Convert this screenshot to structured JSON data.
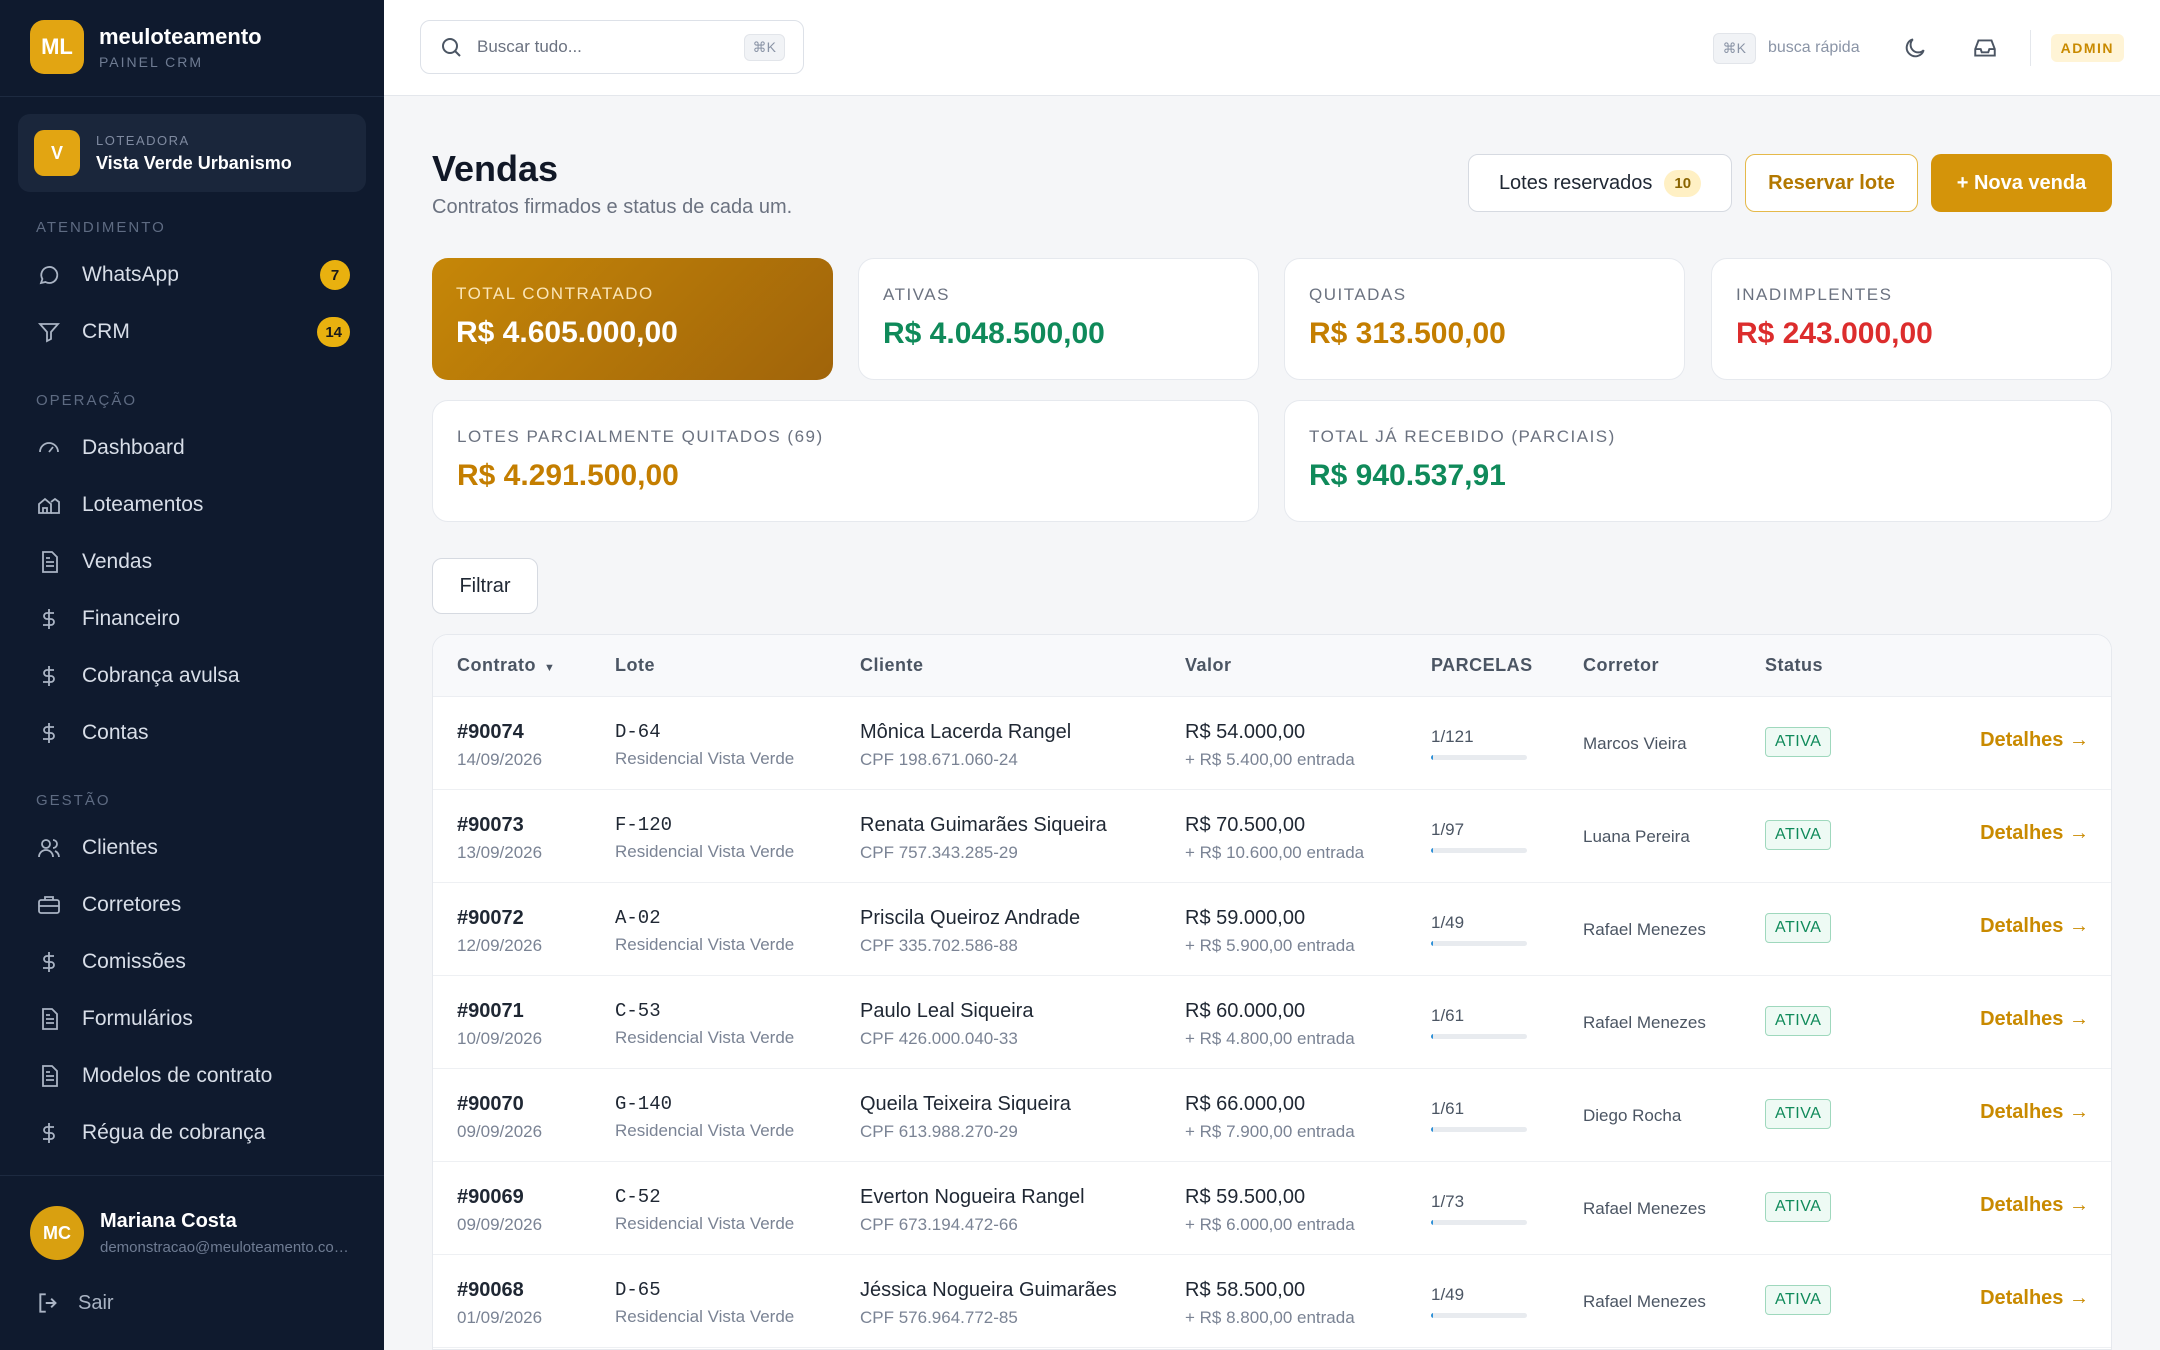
{
  "brand": {
    "logo": "ML",
    "name": "meuloteamento",
    "subtitle": "PAINEL CRM"
  },
  "org": {
    "badge": "V",
    "label": "LOTEADORA",
    "name": "Vista Verde Urbanismo"
  },
  "sidebar": {
    "sections": [
      {
        "label": "ATENDIMENTO"
      },
      {
        "label": "OPERAÇÃO"
      },
      {
        "label": "GESTÃO"
      }
    ],
    "items": [
      {
        "label": "WhatsApp",
        "icon": "chat-icon",
        "badge": "7"
      },
      {
        "label": "CRM",
        "icon": "filter-icon",
        "badge": "14"
      },
      {
        "label": "Dashboard",
        "icon": "gauge-icon"
      },
      {
        "label": "Loteamentos",
        "icon": "houses-icon"
      },
      {
        "label": "Vendas",
        "icon": "document-icon"
      },
      {
        "label": "Financeiro",
        "icon": "dollar-icon"
      },
      {
        "label": "Cobrança avulsa",
        "icon": "dollar-icon"
      },
      {
        "label": "Contas",
        "icon": "dollar-icon"
      },
      {
        "label": "Clientes",
        "icon": "users-icon"
      },
      {
        "label": "Corretores",
        "icon": "briefcase-icon"
      },
      {
        "label": "Comissões",
        "icon": "dollar-icon"
      },
      {
        "label": "Formulários",
        "icon": "document-icon"
      },
      {
        "label": "Modelos de contrato",
        "icon": "document-icon"
      },
      {
        "label": "Régua de cobrança",
        "icon": "dollar-icon"
      }
    ]
  },
  "user": {
    "initials": "MC",
    "name": "Mariana Costa",
    "email": "demonstracao@meuloteamento.com.br",
    "logout": "Sair"
  },
  "topbar": {
    "search_placeholder": "Buscar tudo...",
    "search_kbd": "⌘K",
    "quick_kbd": "⌘K",
    "quick_label": "busca rápida",
    "role": "ADMIN"
  },
  "page": {
    "title": "Vendas",
    "subtitle": "Contratos firmados e status de cada um.",
    "reserved_label": "Lotes reservados",
    "reserved_count": "10",
    "reserve_button": "Reservar lote",
    "new_button": "+ Nova venda",
    "filter_button": "Filtrar"
  },
  "stats": [
    {
      "label": "TOTAL CONTRATADO",
      "value": "R$ 4.605.000,00"
    },
    {
      "label": "ATIVAS",
      "value": "R$ 4.048.500,00"
    },
    {
      "label": "QUITADAS",
      "value": "R$ 313.500,00"
    },
    {
      "label": "INADIMPLENTES",
      "value": "R$ 243.000,00"
    },
    {
      "label": "LOTES PARCIALMENTE QUITADOS (69)",
      "value": "R$ 4.291.500,00"
    },
    {
      "label": "TOTAL JÁ RECEBIDO (PARCIAIS)",
      "value": "R$ 940.537,91"
    }
  ],
  "table": {
    "columns": [
      "Contrato",
      "Lote",
      "Cliente",
      "Valor",
      "PARCELAS",
      "Corretor",
      "Status"
    ],
    "rows": [
      {
        "contrato": "#90074",
        "data": "14/09/2026",
        "lote": "D-64",
        "loteamento": "Residencial Vista Verde",
        "cliente": "Mônica Lacerda Rangel",
        "cpf": "CPF 198.671.060-24",
        "valor": "R$ 54.000,00",
        "entrada": "+ R$ 5.400,00 entrada",
        "parcelas": "1/121",
        "progress": 0.008,
        "corretor": "Marcos Vieira",
        "status": "ATIVA",
        "acao": "Detalhes →"
      },
      {
        "contrato": "#90073",
        "data": "13/09/2026",
        "lote": "F-120",
        "loteamento": "Residencial Vista Verde",
        "cliente": "Renata Guimarães Siqueira",
        "cpf": "CPF 757.343.285-29",
        "valor": "R$ 70.500,00",
        "entrada": "+ R$ 10.600,00 entrada",
        "parcelas": "1/97",
        "progress": 0.01,
        "corretor": "Luana Pereira",
        "status": "ATIVA",
        "acao": "Detalhes →"
      },
      {
        "contrato": "#90072",
        "data": "12/09/2026",
        "lote": "A-02",
        "loteamento": "Residencial Vista Verde",
        "cliente": "Priscila Queiroz Andrade",
        "cpf": "CPF 335.702.586-88",
        "valor": "R$ 59.000,00",
        "entrada": "+ R$ 5.900,00 entrada",
        "parcelas": "1/49",
        "progress": 0.02,
        "corretor": "Rafael Menezes",
        "status": "ATIVA",
        "acao": "Detalhes →"
      },
      {
        "contrato": "#90071",
        "data": "10/09/2026",
        "lote": "C-53",
        "loteamento": "Residencial Vista Verde",
        "cliente": "Paulo Leal Siqueira",
        "cpf": "CPF 426.000.040-33",
        "valor": "R$ 60.000,00",
        "entrada": "+ R$ 4.800,00 entrada",
        "parcelas": "1/61",
        "progress": 0.016,
        "corretor": "Rafael Menezes",
        "status": "ATIVA",
        "acao": "Detalhes →"
      },
      {
        "contrato": "#90070",
        "data": "09/09/2026",
        "lote": "G-140",
        "loteamento": "Residencial Vista Verde",
        "cliente": "Queila Teixeira Siqueira",
        "cpf": "CPF 613.988.270-29",
        "valor": "R$ 66.000,00",
        "entrada": "+ R$ 7.900,00 entrada",
        "parcelas": "1/61",
        "progress": 0.016,
        "corretor": "Diego Rocha",
        "status": "ATIVA",
        "acao": "Detalhes →"
      },
      {
        "contrato": "#90069",
        "data": "09/09/2026",
        "lote": "C-52",
        "loteamento": "Residencial Vista Verde",
        "cliente": "Everton Nogueira Rangel",
        "cpf": "CPF 673.194.472-66",
        "valor": "R$ 59.500,00",
        "entrada": "+ R$ 6.000,00 entrada",
        "parcelas": "1/73",
        "progress": 0.014,
        "corretor": "Rafael Menezes",
        "status": "ATIVA",
        "acao": "Detalhes →"
      },
      {
        "contrato": "#90068",
        "data": "01/09/2026",
        "lote": "D-65",
        "loteamento": "Residencial Vista Verde",
        "cliente": "Jéssica Nogueira Guimarães",
        "cpf": "CPF 576.964.772-85",
        "valor": "R$ 58.500,00",
        "entrada": "+ R$ 8.800,00 entrada",
        "parcelas": "1/49",
        "progress": 0.02,
        "corretor": "Rafael Menezes",
        "status": "ATIVA",
        "acao": "Detalhes →"
      }
    ]
  },
  "colors": {
    "accent": "#d4940a",
    "sidebar": "#0f1a2e",
    "success": "#0f8a5a",
    "danger": "#dc2d2d",
    "warning": "#c47e00"
  }
}
